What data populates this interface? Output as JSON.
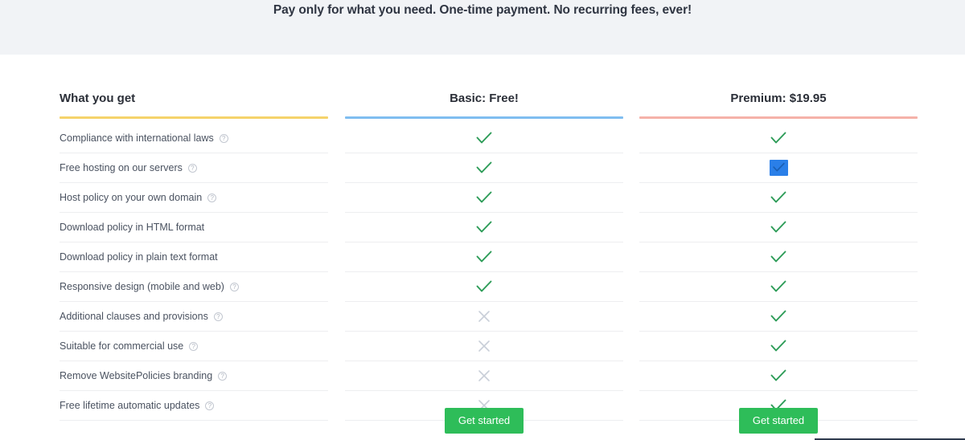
{
  "banner": {
    "tagline": "Pay only for what you need. One-time payment. No recurring fees, ever!",
    "background": "#f1f3f6"
  },
  "columns": {
    "features": {
      "label": "What you get",
      "rule_color": "#f5d36b"
    },
    "basic": {
      "label": "Basic: Free!",
      "rule_color": "#7fbdf0"
    },
    "premium": {
      "label": "Premium: $19.95",
      "rule_color": "#f5b2a9"
    }
  },
  "icons": {
    "help": "?",
    "check": "check-icon",
    "cross": "cross-icon",
    "check_color": "#2d9c58",
    "cross_color": "#c9cfd8",
    "selection_color": "#2a7fe8"
  },
  "rows": [
    {
      "feature": "Compliance with international laws",
      "help": true,
      "basic": "yes",
      "premium": "yes",
      "premium_selected": false
    },
    {
      "feature": "Free hosting on our servers",
      "help": true,
      "basic": "yes",
      "premium": "yes",
      "premium_selected": true
    },
    {
      "feature": "Host policy on your own domain",
      "help": true,
      "basic": "yes",
      "premium": "yes",
      "premium_selected": false
    },
    {
      "feature": "Download policy in HTML format",
      "help": false,
      "basic": "yes",
      "premium": "yes",
      "premium_selected": false
    },
    {
      "feature": "Download policy in plain text format",
      "help": false,
      "basic": "yes",
      "premium": "yes",
      "premium_selected": false
    },
    {
      "feature": "Responsive design (mobile and web)",
      "help": true,
      "basic": "yes",
      "premium": "yes",
      "premium_selected": false
    },
    {
      "feature": "Additional clauses and provisions",
      "help": true,
      "basic": "no",
      "premium": "yes",
      "premium_selected": false
    },
    {
      "feature": "Suitable for commercial use",
      "help": true,
      "basic": "no",
      "premium": "yes",
      "premium_selected": false
    },
    {
      "feature": "Remove WebsitePolicies branding",
      "help": true,
      "basic": "no",
      "premium": "yes",
      "premium_selected": false
    },
    {
      "feature": "Free lifetime automatic updates",
      "help": true,
      "basic": "no",
      "premium": "yes",
      "premium_selected": false
    }
  ],
  "cta": {
    "basic_label": "Get started",
    "premium_label": "Get started",
    "button_color": "#2ebd59"
  }
}
